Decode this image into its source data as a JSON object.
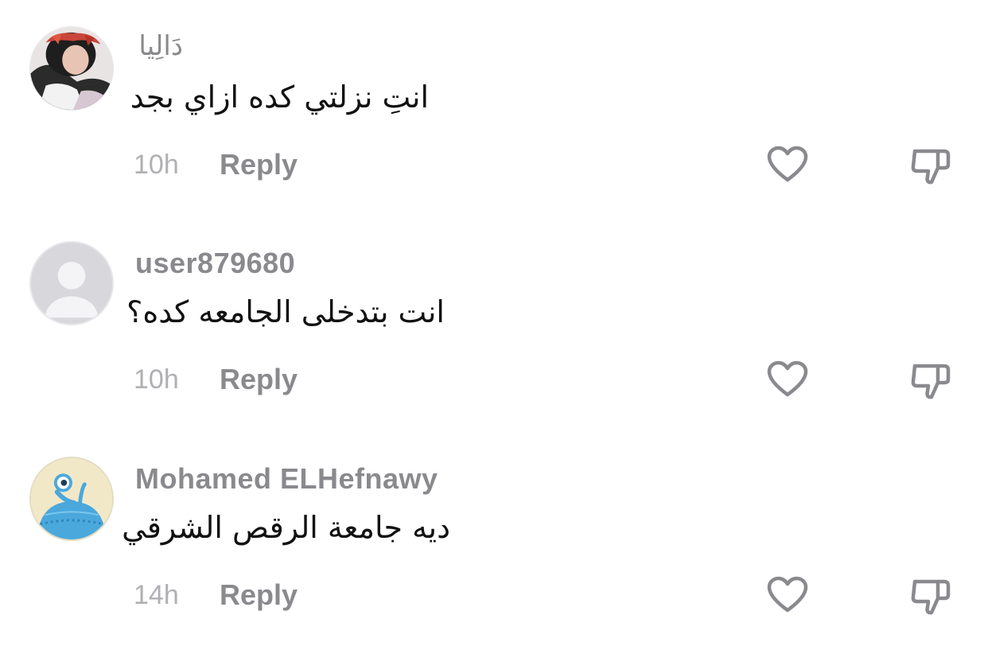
{
  "comments": [
    {
      "username": "دَالِيا",
      "text": "انتِ نزلتي كده ازاي بجد",
      "time": "10h",
      "reply_label": "Reply",
      "avatar_icon": "profile-photo-hijab"
    },
    {
      "username": "user879680",
      "text": "انت بتدخلى الجامعه كده؟",
      "time": "10h",
      "reply_label": "Reply",
      "avatar_icon": "default-avatar"
    },
    {
      "username": "Mohamed ELHefnawy",
      "text": "ديه جامعة الرقص الشرقي",
      "time": "14h",
      "reply_label": "Reply",
      "avatar_icon": "cartoon-alien-avatar"
    }
  ],
  "icons": {
    "like": "heart-outline-icon",
    "dislike": "thumbs-down-outline-icon"
  },
  "colors": {
    "username": "#8a8a8e",
    "timestamp": "#b0b0b4",
    "icon": "#8a8a8e",
    "text": "#111111"
  }
}
